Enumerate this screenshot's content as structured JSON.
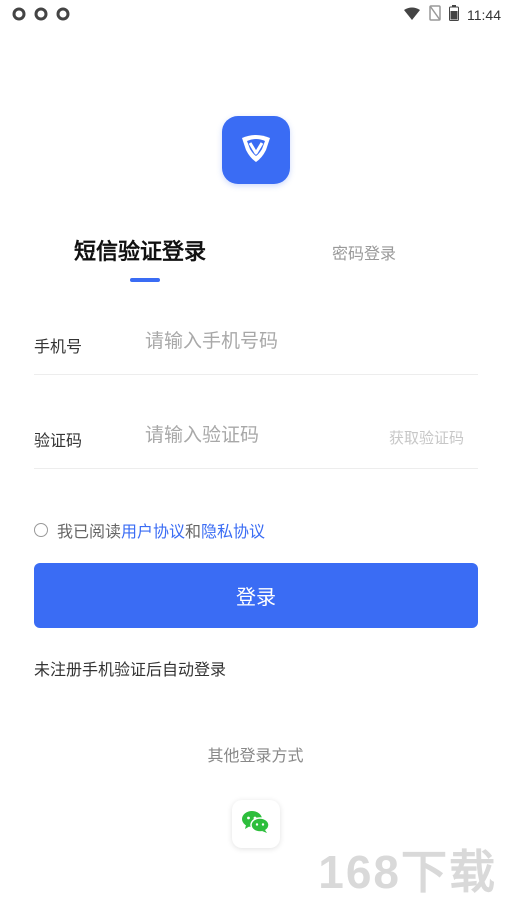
{
  "status_bar": {
    "time": "11:44",
    "left_icons": [
      "circle-icon",
      "circle-icon",
      "circle-icon"
    ],
    "right_icons": [
      "wifi-icon",
      "no-sim-icon",
      "battery-icon"
    ]
  },
  "brand": {
    "accent_color": "#3A6CF4",
    "logo_icon": "v-shield-icon"
  },
  "tabs": {
    "active": "短信验证登录",
    "inactive": "密码登录"
  },
  "phone_field": {
    "label": "手机号",
    "placeholder": "请输入手机号码",
    "value": ""
  },
  "code_field": {
    "label": "验证码",
    "placeholder": "请输入验证码",
    "value": "",
    "get_code": "获取验证码"
  },
  "agreement": {
    "prefix": "我已阅读",
    "user_agreement": "用户协议",
    "and": "和",
    "privacy_agreement": "隐私协议",
    "checked": false
  },
  "login_button": "登录",
  "auto_register_note": "未注册手机验证后自动登录",
  "other_login": {
    "title": "其他登录方式",
    "methods": [
      "wechat-icon"
    ]
  },
  "watermark": "168下载"
}
